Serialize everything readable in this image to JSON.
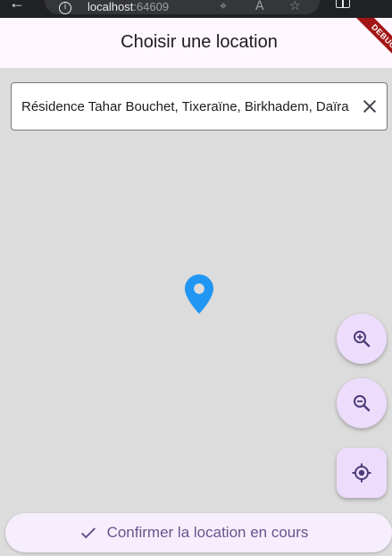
{
  "browser": {
    "back_icon": "←",
    "url_host": "localhost",
    "url_port": ":64609"
  },
  "app_bar": {
    "title": "Choisir une location",
    "debug_banner": "DEBUG"
  },
  "search": {
    "value": "Résidence Tahar Bouchet, Tixeraïne, Birkhadem, Daïra de Birkhadem"
  },
  "confirm_button": {
    "label": "Confirmer la location en cours"
  },
  "colors": {
    "app_bar_bg": "#fef7ff",
    "map_bg": "#dcdcdc",
    "pin": "#2196f3",
    "fab_bg": "#eddcfb",
    "fab_icon": "#4b3d79",
    "confirm_bg": "#f6eefc",
    "confirm_text": "#66558f",
    "debug_banner": "#a31515"
  },
  "icons": {
    "fab_zoom_in": "zoom-in-icon",
    "fab_zoom_out": "zoom-out-icon",
    "fab_locate": "my-location-icon",
    "confirm": "check-icon",
    "clear": "close-icon",
    "map_marker": "location-pin-icon"
  }
}
